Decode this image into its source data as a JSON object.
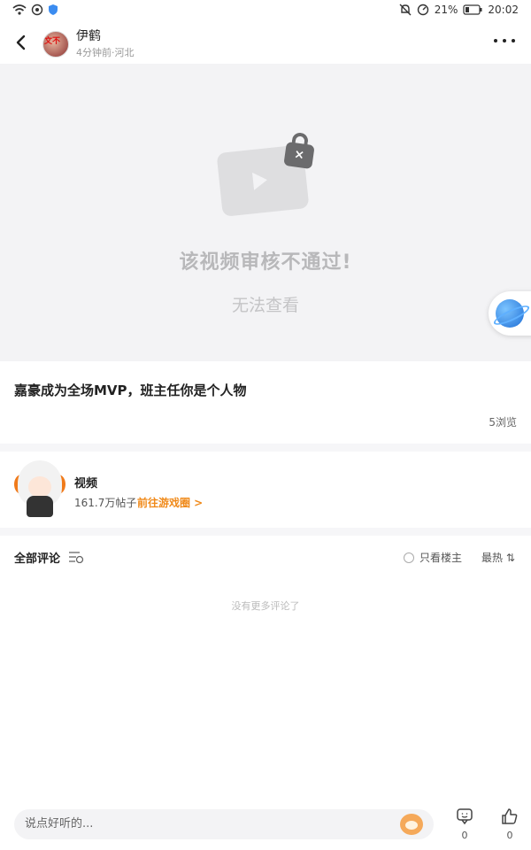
{
  "status_bar": {
    "battery": "21%",
    "time": "20:02"
  },
  "header": {
    "username": "伊鹤",
    "meta": "4分钟前·河北",
    "avatar_badge": "文不"
  },
  "video": {
    "title": "该视频审核不通过!",
    "subtitle": "无法查看"
  },
  "post": {
    "title": "嘉豪成为全场MVP，班主任你是个人物",
    "views": "5浏览"
  },
  "circle": {
    "name": "视频",
    "posts": "161.7万帖子",
    "go_label": "前往游戏圈 >"
  },
  "comments": {
    "title": "全部评论",
    "only_owner": "只看楼主",
    "sort": "最热 ⇅",
    "empty": "没有更多评论了"
  },
  "bottom_bar": {
    "input_placeholder": "说点好听的...",
    "comment_count": "0",
    "like_count": "0"
  },
  "colors": {
    "accent": "#f08a1a",
    "planet": "#1f6fd6"
  }
}
